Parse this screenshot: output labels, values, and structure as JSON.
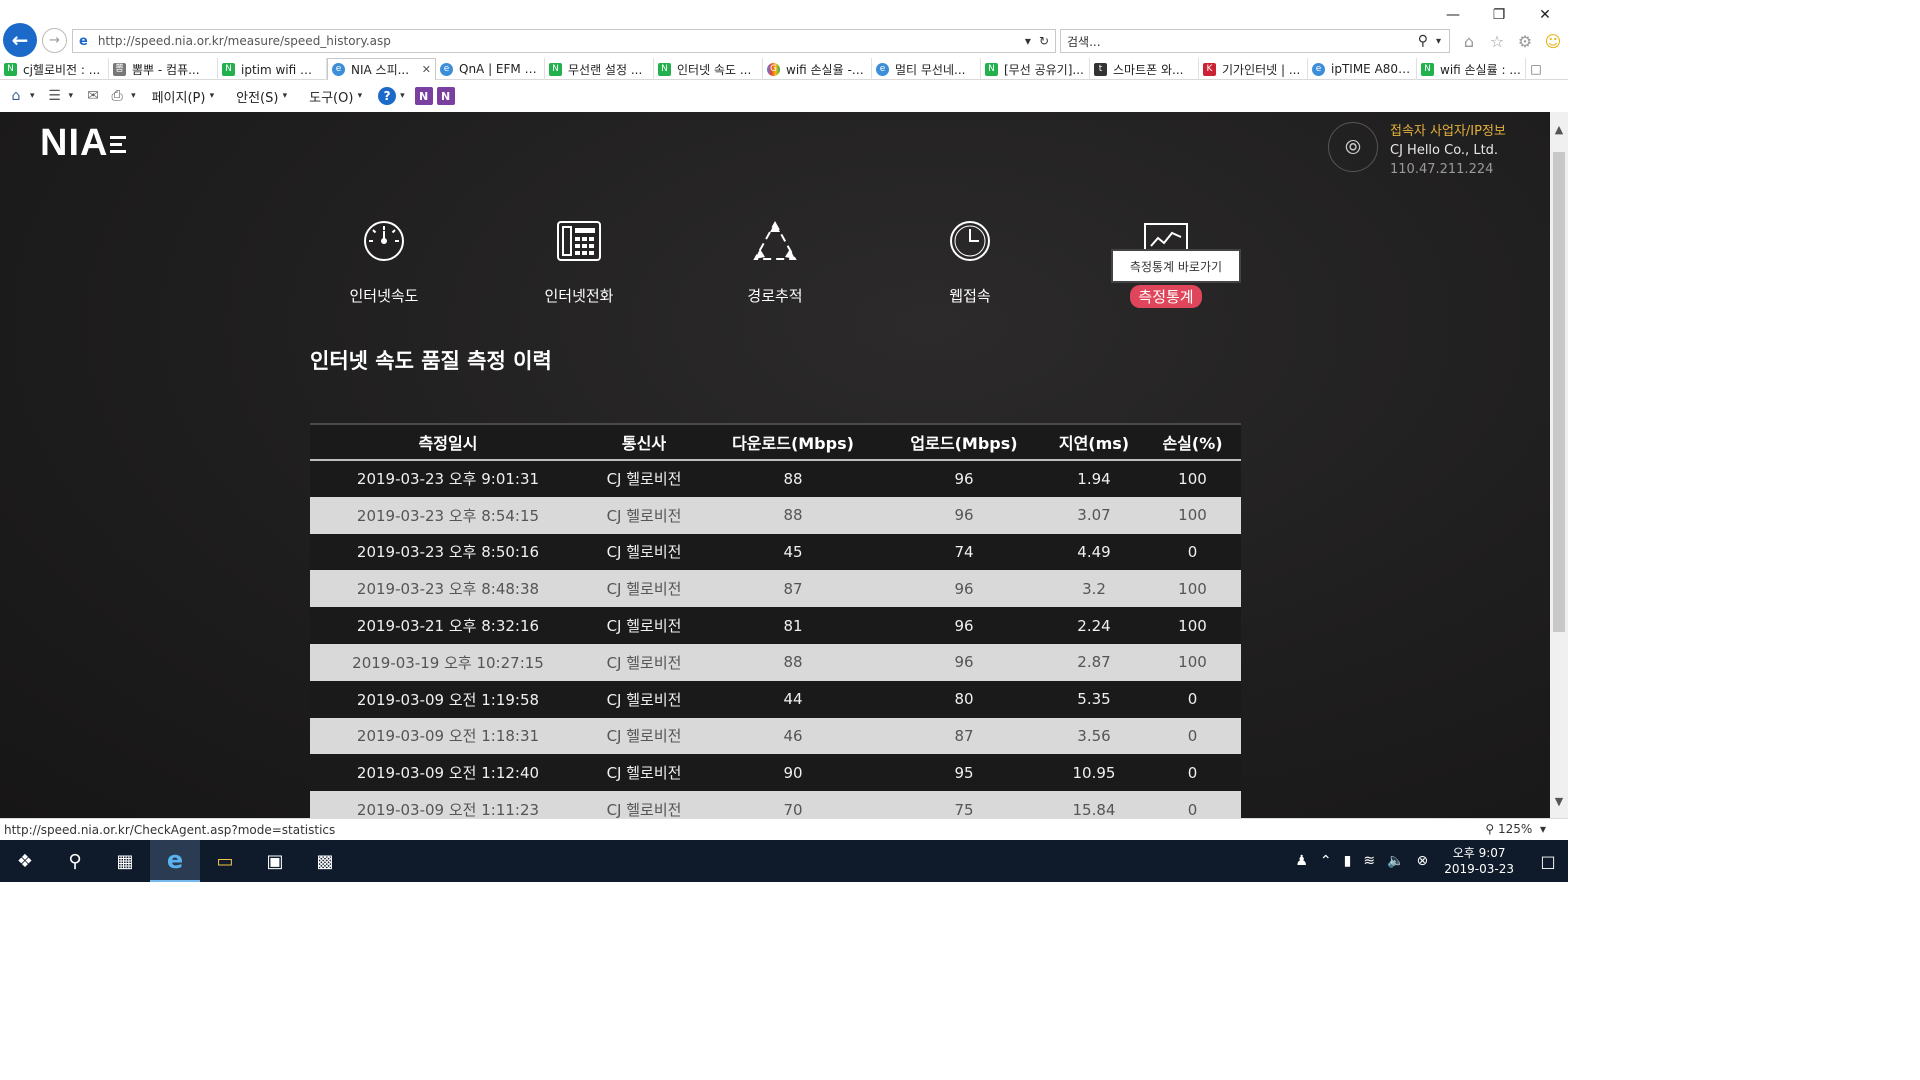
{
  "browser": {
    "address_url": "http://speed.nia.or.kr/measure/speed_history.asp",
    "search_placeholder": "검색...",
    "tabs": [
      {
        "label": "cj헬로비전 : ...",
        "fav": "green",
        "fav_text": "N",
        "active": false
      },
      {
        "label": "뽐뿌 - 컴퓨...",
        "fav": "grey",
        "fav_text": "뽐",
        "active": false
      },
      {
        "label": "iptim wifi 손...",
        "fav": "green",
        "fav_text": "N",
        "active": false
      },
      {
        "label": "NIA 스피...",
        "fav": "blue",
        "fav_text": "e",
        "active": true
      },
      {
        "label": "QnA | EFM - ...",
        "fav": "blue",
        "fav_text": "e",
        "active": false
      },
      {
        "label": "무선랜 설정 ...",
        "fav": "green",
        "fav_text": "N",
        "active": false
      },
      {
        "label": "인터넷 속도 ...",
        "fav": "green",
        "fav_text": "N",
        "active": false
      },
      {
        "label": "wifi 손실율 - ...",
        "fav": "multi",
        "fav_text": "G",
        "active": false
      },
      {
        "label": "멀티 무선네...",
        "fav": "blue",
        "fav_text": "e",
        "active": false
      },
      {
        "label": "[무선 공유기]...",
        "fav": "green",
        "fav_text": "N",
        "active": false
      },
      {
        "label": "스마트폰 와...",
        "fav": "dark",
        "fav_text": "t",
        "active": false
      },
      {
        "label": "기가인터넷 | ...",
        "fav": "red",
        "fav_text": "K",
        "active": false
      },
      {
        "label": "ipTIME A800...",
        "fav": "blue",
        "fav_text": "e",
        "active": false
      },
      {
        "label": "wifi 손실률 : ...",
        "fav": "green",
        "fav_text": "N",
        "active": false
      }
    ],
    "menus": {
      "page": "페이지(P)",
      "safety": "안전(S)",
      "tools": "도구(O)"
    },
    "status_url": "http://speed.nia.or.kr/CheckAgent.asp?mode=statistics",
    "zoom": "125%"
  },
  "site": {
    "logo": "NIA",
    "isp_heading": "접속자 사업자/IP정보",
    "isp_name": "CJ Hello Co., Ltd.",
    "isp_ip": "110.47.211.224",
    "nav": [
      {
        "label": "인터넷속도",
        "icon": "speedometer-icon"
      },
      {
        "label": "인터넷전화",
        "icon": "phone-icon"
      },
      {
        "label": "경로추적",
        "icon": "route-trace-icon"
      },
      {
        "label": "웹접속",
        "icon": "clock-icon"
      },
      {
        "label": "측정통계",
        "icon": "chart-icon"
      }
    ],
    "tooltip": "측정통계 바로가기",
    "page_title": "인터넷 속도 품질 측정 이력",
    "table": {
      "headers": [
        "측정일시",
        "통신사",
        "다운로드(Mbps)",
        "업로드(Mbps)",
        "지연(ms)",
        "손실(%)"
      ],
      "rows": [
        [
          "2019-03-23 오후 9:01:31",
          "CJ 헬로비전",
          "88",
          "96",
          "1.94",
          "100"
        ],
        [
          "2019-03-23 오후 8:54:15",
          "CJ 헬로비전",
          "88",
          "96",
          "3.07",
          "100"
        ],
        [
          "2019-03-23 오후 8:50:16",
          "CJ 헬로비전",
          "45",
          "74",
          "4.49",
          "0"
        ],
        [
          "2019-03-23 오후 8:48:38",
          "CJ 헬로비전",
          "87",
          "96",
          "3.2",
          "100"
        ],
        [
          "2019-03-21 오후 8:32:16",
          "CJ 헬로비전",
          "81",
          "96",
          "2.24",
          "100"
        ],
        [
          "2019-03-19 오후 10:27:15",
          "CJ 헬로비전",
          "88",
          "96",
          "2.87",
          "100"
        ],
        [
          "2019-03-09 오전 1:19:58",
          "CJ 헬로비전",
          "44",
          "80",
          "5.35",
          "0"
        ],
        [
          "2019-03-09 오전 1:18:31",
          "CJ 헬로비전",
          "46",
          "87",
          "3.56",
          "0"
        ],
        [
          "2019-03-09 오전 1:12:40",
          "CJ 헬로비전",
          "90",
          "95",
          "10.95",
          "0"
        ],
        [
          "2019-03-09 오전 1:11:23",
          "CJ 헬로비전",
          "70",
          "75",
          "15.84",
          "0"
        ]
      ]
    }
  },
  "taskbar": {
    "time": "오후 9:07",
    "date": "2019-03-23"
  },
  "colors": {
    "accent_pink": "#e0465b",
    "isp_heading": "#e2b03c",
    "ie_blue": "#1b6ac9"
  }
}
